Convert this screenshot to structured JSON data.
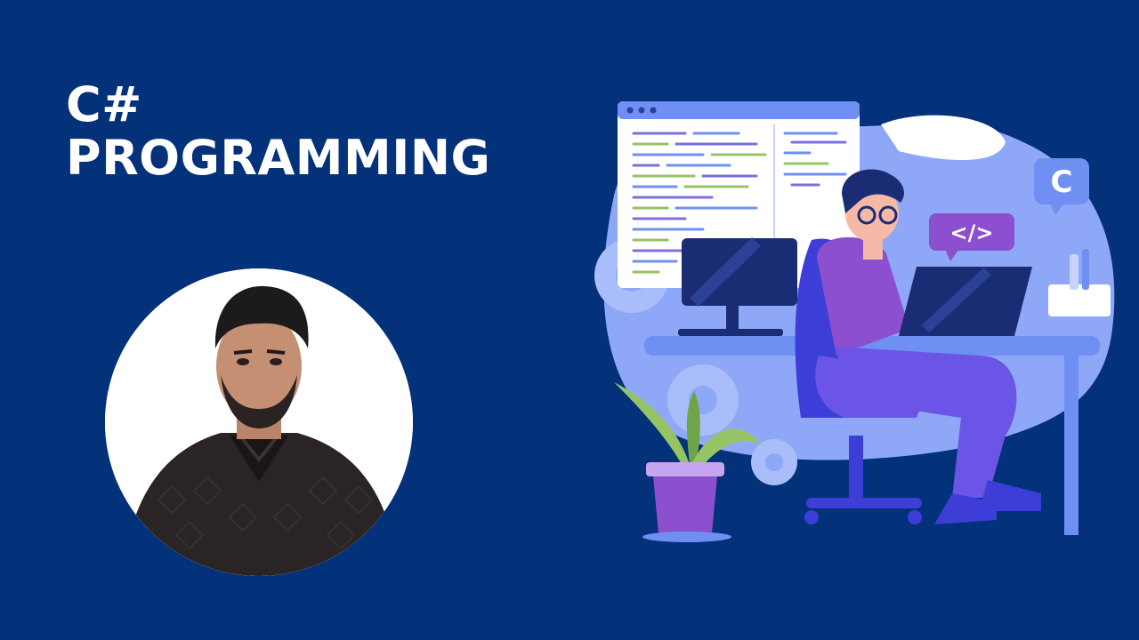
{
  "slide": {
    "title_line1": "C#",
    "title_line2": "PROGRAMMING"
  },
  "illustration": {
    "code_tag": "</>",
    "language_badge": "C"
  },
  "colors": {
    "background": "#03317a",
    "title_text": "#ffffff",
    "blob": "#8ea8f7",
    "purple": "#7b4fd0",
    "accent_blue": "#5b7bf0"
  },
  "icons": [
    "person-portrait",
    "developer-illustration",
    "code-tag-icon",
    "c-language-badge-icon",
    "gear-icon",
    "plant-icon"
  ]
}
